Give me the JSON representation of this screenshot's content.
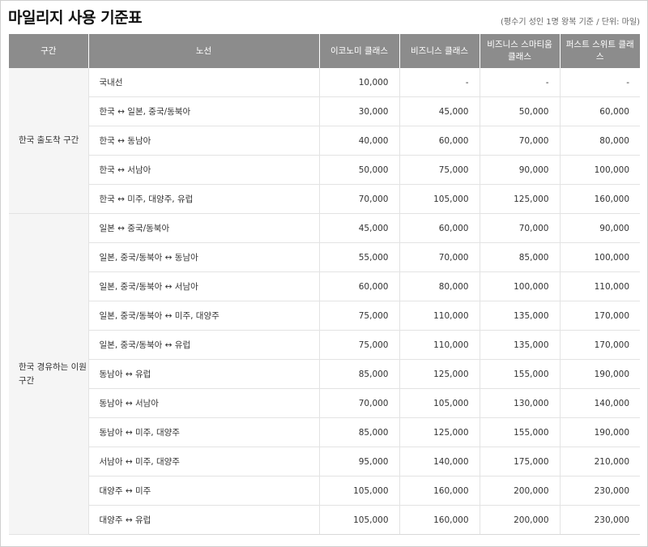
{
  "page": {
    "title": "마일리지 사용 기준표",
    "note": "(평수기 성인 1명 왕복 기준 / 단위: 마일)"
  },
  "table": {
    "headers": [
      "구간",
      "노선",
      "이코노미 클래스",
      "비즈니스 클래스",
      "비즈니스 스마티움 클래스",
      "퍼스트 스위트 클래스"
    ],
    "sections": [
      {
        "label": "한국 출도착 구간",
        "rows": [
          {
            "route": "국내선",
            "economy": "10,000",
            "business": "-",
            "smartium": "-",
            "first": "-"
          },
          {
            "route": "한국 ↔ 일본, 중국/동북아",
            "economy": "30,000",
            "business": "45,000",
            "smartium": "50,000",
            "first": "60,000"
          },
          {
            "route": "한국 ↔ 동남아",
            "economy": "40,000",
            "business": "60,000",
            "smartium": "70,000",
            "first": "80,000"
          },
          {
            "route": "한국 ↔ 서남아",
            "economy": "50,000",
            "business": "75,000",
            "smartium": "90,000",
            "first": "100,000"
          },
          {
            "route": "한국 ↔ 미주, 대양주, 유럽",
            "economy": "70,000",
            "business": "105,000",
            "smartium": "125,000",
            "first": "160,000"
          }
        ]
      },
      {
        "label": "한국 경유하는 이원구간",
        "rows": [
          {
            "route": "일본 ↔ 중국/동북아",
            "economy": "45,000",
            "business": "60,000",
            "smartium": "70,000",
            "first": "90,000"
          },
          {
            "route": "일본, 중국/동북아 ↔ 동남아",
            "economy": "55,000",
            "business": "70,000",
            "smartium": "85,000",
            "first": "100,000"
          },
          {
            "route": "일본, 중국/동북아 ↔ 서남아",
            "economy": "60,000",
            "business": "80,000",
            "smartium": "100,000",
            "first": "110,000"
          },
          {
            "route": "일본, 중국/동북아 ↔ 미주, 대양주",
            "economy": "75,000",
            "business": "110,000",
            "smartium": "135,000",
            "first": "170,000"
          },
          {
            "route": "일본, 중국/동북아 ↔ 유럽",
            "economy": "75,000",
            "business": "110,000",
            "smartium": "135,000",
            "first": "170,000"
          },
          {
            "route": "동남아 ↔ 유럽",
            "economy": "85,000",
            "business": "125,000",
            "smartium": "155,000",
            "first": "190,000"
          },
          {
            "route": "동남아 ↔ 서남아",
            "economy": "70,000",
            "business": "105,000",
            "smartium": "130,000",
            "first": "140,000"
          },
          {
            "route": "동남아 ↔ 미주, 대양주",
            "economy": "85,000",
            "business": "125,000",
            "smartium": "155,000",
            "first": "190,000"
          },
          {
            "route": "서남아 ↔ 미주, 대양주",
            "economy": "95,000",
            "business": "140,000",
            "smartium": "175,000",
            "first": "210,000"
          },
          {
            "route": "대양주 ↔ 미주",
            "economy": "105,000",
            "business": "160,000",
            "smartium": "200,000",
            "first": "230,000"
          },
          {
            "route": "대양주 ↔ 유럽",
            "economy": "105,000",
            "business": "160,000",
            "smartium": "200,000",
            "first": "230,000"
          }
        ]
      }
    ]
  }
}
